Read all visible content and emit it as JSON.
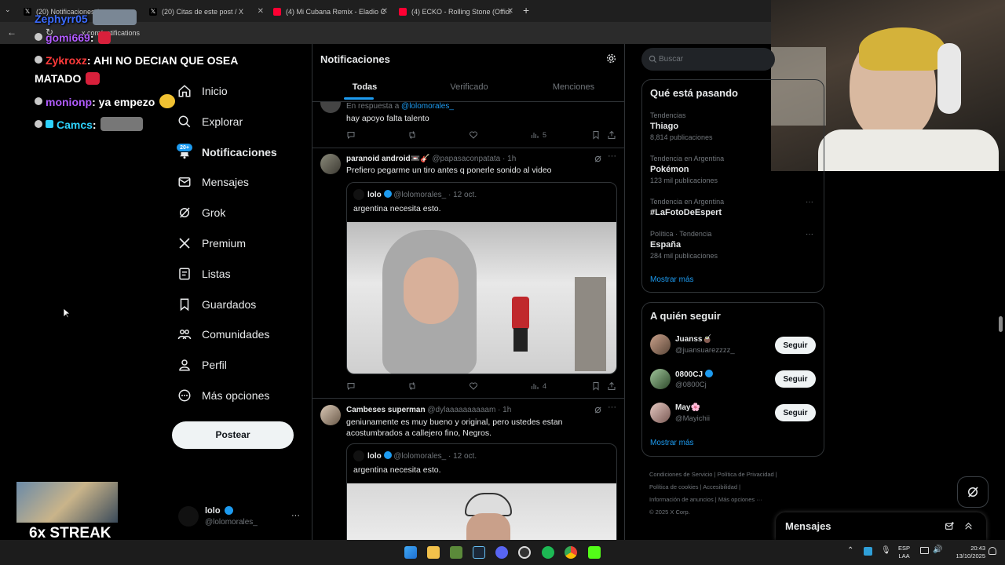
{
  "browser": {
    "tabs": [
      {
        "title": "(20) Notificaciones /",
        "color": "#ffffff"
      },
      {
        "title": "(20) Citas de este post / X",
        "color": "#ffffff"
      },
      {
        "title": "(4) Mi Cubana Remix - Eladio C",
        "color": "#ff0033"
      },
      {
        "title": "(4) ECKO - Rolling Stone (Offici",
        "color": "#ff0033"
      }
    ],
    "new_tab": "+",
    "url": "x.com/notifications"
  },
  "stream_overlay": {
    "chat": [
      {
        "user": "Zephyrr05",
        "text": "",
        "color": "#3b6bff"
      },
      {
        "user": "gomi669",
        "text": ":",
        "color": "#b25cff"
      },
      {
        "user": "Zykroxz",
        "text": ": AHI NO DECIAN QUE OSEA",
        "color": "#ff3b3b"
      },
      {
        "user": "",
        "text": "MATADO",
        "color": "#ffffff"
      },
      {
        "user": "monionp",
        "text": ": ya empezo",
        "color": "#b25cff"
      },
      {
        "user": "Camcs",
        "text": ":",
        "color": "#2ed3ff"
      }
    ],
    "streak": "6x STREAK"
  },
  "nav": {
    "items": [
      {
        "label": "Inicio",
        "icon": "home-icon"
      },
      {
        "label": "Explorar",
        "icon": "search-icon"
      },
      {
        "label": "Notificaciones",
        "icon": "bell-icon",
        "badge": "20+"
      },
      {
        "label": "Mensajes",
        "icon": "mail-icon"
      },
      {
        "label": "Grok",
        "icon": "grok-icon"
      },
      {
        "label": "Premium",
        "icon": "x-logo-icon"
      },
      {
        "label": "Listas",
        "icon": "list-icon"
      },
      {
        "label": "Guardados",
        "icon": "bookmark-icon"
      },
      {
        "label": "Comunidades",
        "icon": "communities-icon"
      },
      {
        "label": "Perfil",
        "icon": "person-icon"
      },
      {
        "label": "Más opciones",
        "icon": "more-circle-icon"
      }
    ],
    "post_button": "Postear",
    "account": {
      "name": "lolo",
      "handle": "@lolomorales_",
      "more": "···"
    }
  },
  "feed": {
    "title": "Notificaciones",
    "tabs": [
      "Todas",
      "Verificado",
      "Menciones"
    ],
    "active_tab": 0,
    "tweet0": {
      "reply_prefix": "En respuesta a",
      "reply_handle": "@lolomorales_",
      "text": "hay apoyo falta talento",
      "views": "5"
    },
    "tweet1": {
      "name": "paranoid android📼🎸",
      "handle": "@papasaconpatata · 1h",
      "text": "Prefiero pegarme un tiro antes q ponerle sonido al video",
      "quote": {
        "name": "lolo",
        "handle": "@lolomorales_ · 12 oct.",
        "text": "argentina necesita esto."
      },
      "views": "4"
    },
    "tweet2": {
      "name": "Cambeses superman",
      "handle": "@dylaaaaaaaaaam · 1h",
      "text": "geniunamente es muy bueno y original, pero ustedes estan acostumbrados a callejero fino, Negros.",
      "quote": {
        "name": "lolo",
        "handle": "@lolomorales_ · 12 oct.",
        "text": "argentina necesita esto."
      }
    }
  },
  "sidebar": {
    "search_placeholder": "Buscar",
    "trending": {
      "title": "Qué está pasando",
      "items": [
        {
          "meta": "Tendencias",
          "name": "Thiago",
          "count": "8,814 publicaciones"
        },
        {
          "meta": "Tendencia en Argentina",
          "name": "Pokémon",
          "count": "123 mil publicaciones"
        },
        {
          "meta": "Tendencia en Argentina",
          "name": "#LaFotoDeEspert",
          "count": ""
        },
        {
          "meta": "Política · Tendencia",
          "name": "España",
          "count": "284 mil publicaciones"
        }
      ],
      "more": "Mostrar más"
    },
    "who_to_follow": {
      "title": "A quién seguir",
      "items": [
        {
          "name": "Juanss🧉",
          "handle": "@juansuarezzzz_",
          "button": "Seguir"
        },
        {
          "name": "0800CJ",
          "handle": "@0800Cj",
          "button": "Seguir"
        },
        {
          "name": "May🌸",
          "handle": "@Mayichii",
          "button": "Seguir"
        }
      ],
      "more": "Mostrar más"
    },
    "footer": [
      "Condiciones de Servicio",
      "Política de Privacidad",
      "Política de cookies",
      "Accesibilidad",
      "Información de anuncios",
      "Más opciones ···",
      "© 2025 X Corp."
    ],
    "messages_title": "Mensajes"
  },
  "taskbar": {
    "lang": "ESP",
    "lang2": "LAA",
    "time": "20:43",
    "date": "13/10/2025"
  },
  "colors": {
    "accent": "#1d9bf0",
    "background": "#000000",
    "border": "#2f3336"
  }
}
